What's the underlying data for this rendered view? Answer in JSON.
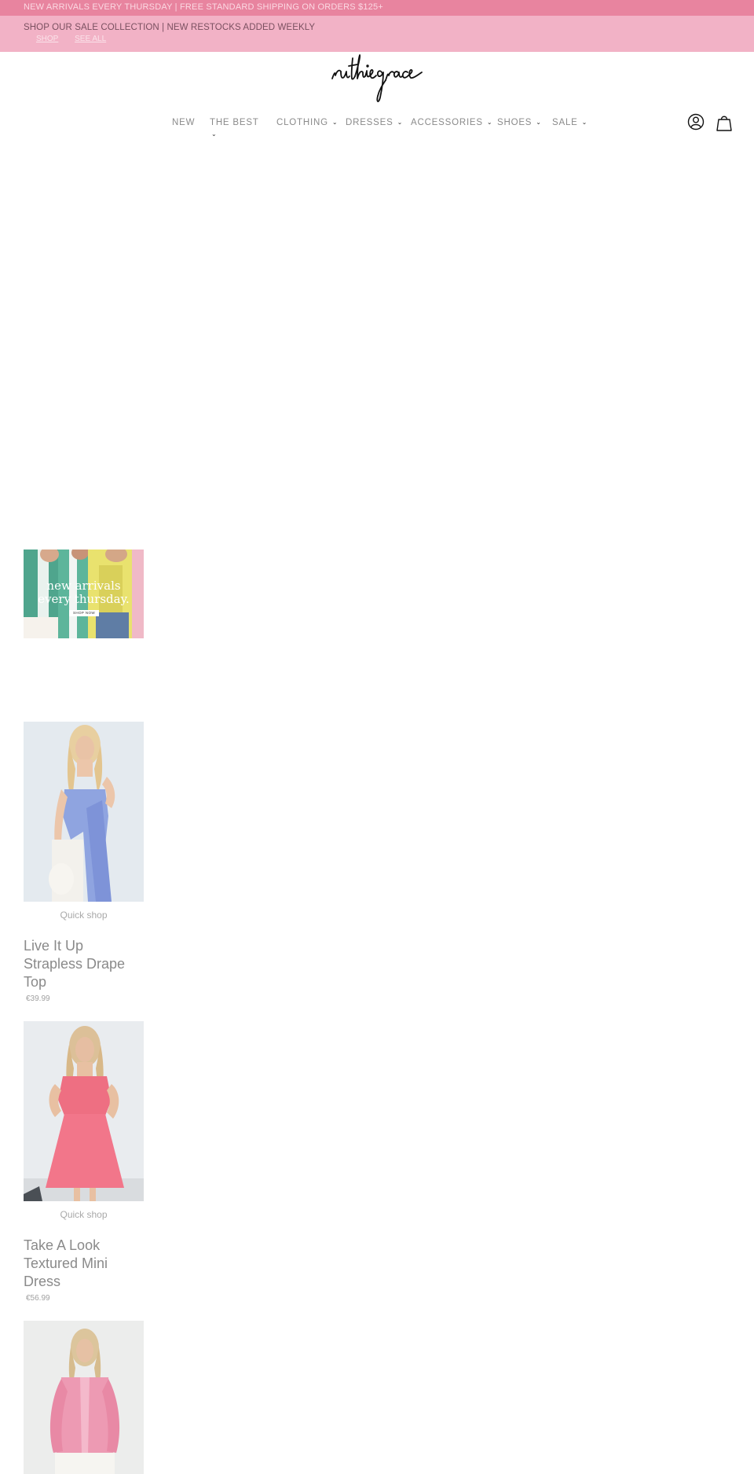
{
  "announcement": {
    "top_text": "NEW ARRIVALS EVERY THURSDAY | FREE STANDARD SHIPPING ON ORDERS $125+",
    "sale_text": "SHOP OUR SALE COLLECTION | NEW RESTOCKS ADDED WEEKLY",
    "links": [
      "SHOP",
      "SEE ALL"
    ]
  },
  "brand": {
    "logo_text": "ruthie grace"
  },
  "nav": {
    "items": [
      {
        "label": "NEW",
        "has_dropdown": false
      },
      {
        "label": "THE BEST",
        "has_dropdown": true
      },
      {
        "label": "CLOTHING",
        "has_dropdown": true
      },
      {
        "label": "DRESSES",
        "has_dropdown": true
      },
      {
        "label": "ACCESSORIES",
        "has_dropdown": true
      },
      {
        "label": "SHOES",
        "has_dropdown": true
      },
      {
        "label": "SALE",
        "has_dropdown": true
      }
    ],
    "account_icon": "user-circle-icon",
    "cart_icon": "shopping-bag-icon"
  },
  "hero_banner": {
    "headline_line1": "new arrivals",
    "headline_line2": "every thursday.",
    "button": "SHOP NOW"
  },
  "products": [
    {
      "quick_shop": "Quick shop",
      "title": "Live It Up Strapless Drape Top",
      "price": "€39.99"
    },
    {
      "quick_shop": "Quick shop",
      "title": "Take A Look Textured Mini Dress",
      "price": "€56.99"
    },
    {
      "quick_shop": "",
      "title": "",
      "price": ""
    }
  ],
  "colors": {
    "top_bar": "#e8849f",
    "sale_bar": "#f2b2c6",
    "text_muted": "#8a8a8a"
  }
}
